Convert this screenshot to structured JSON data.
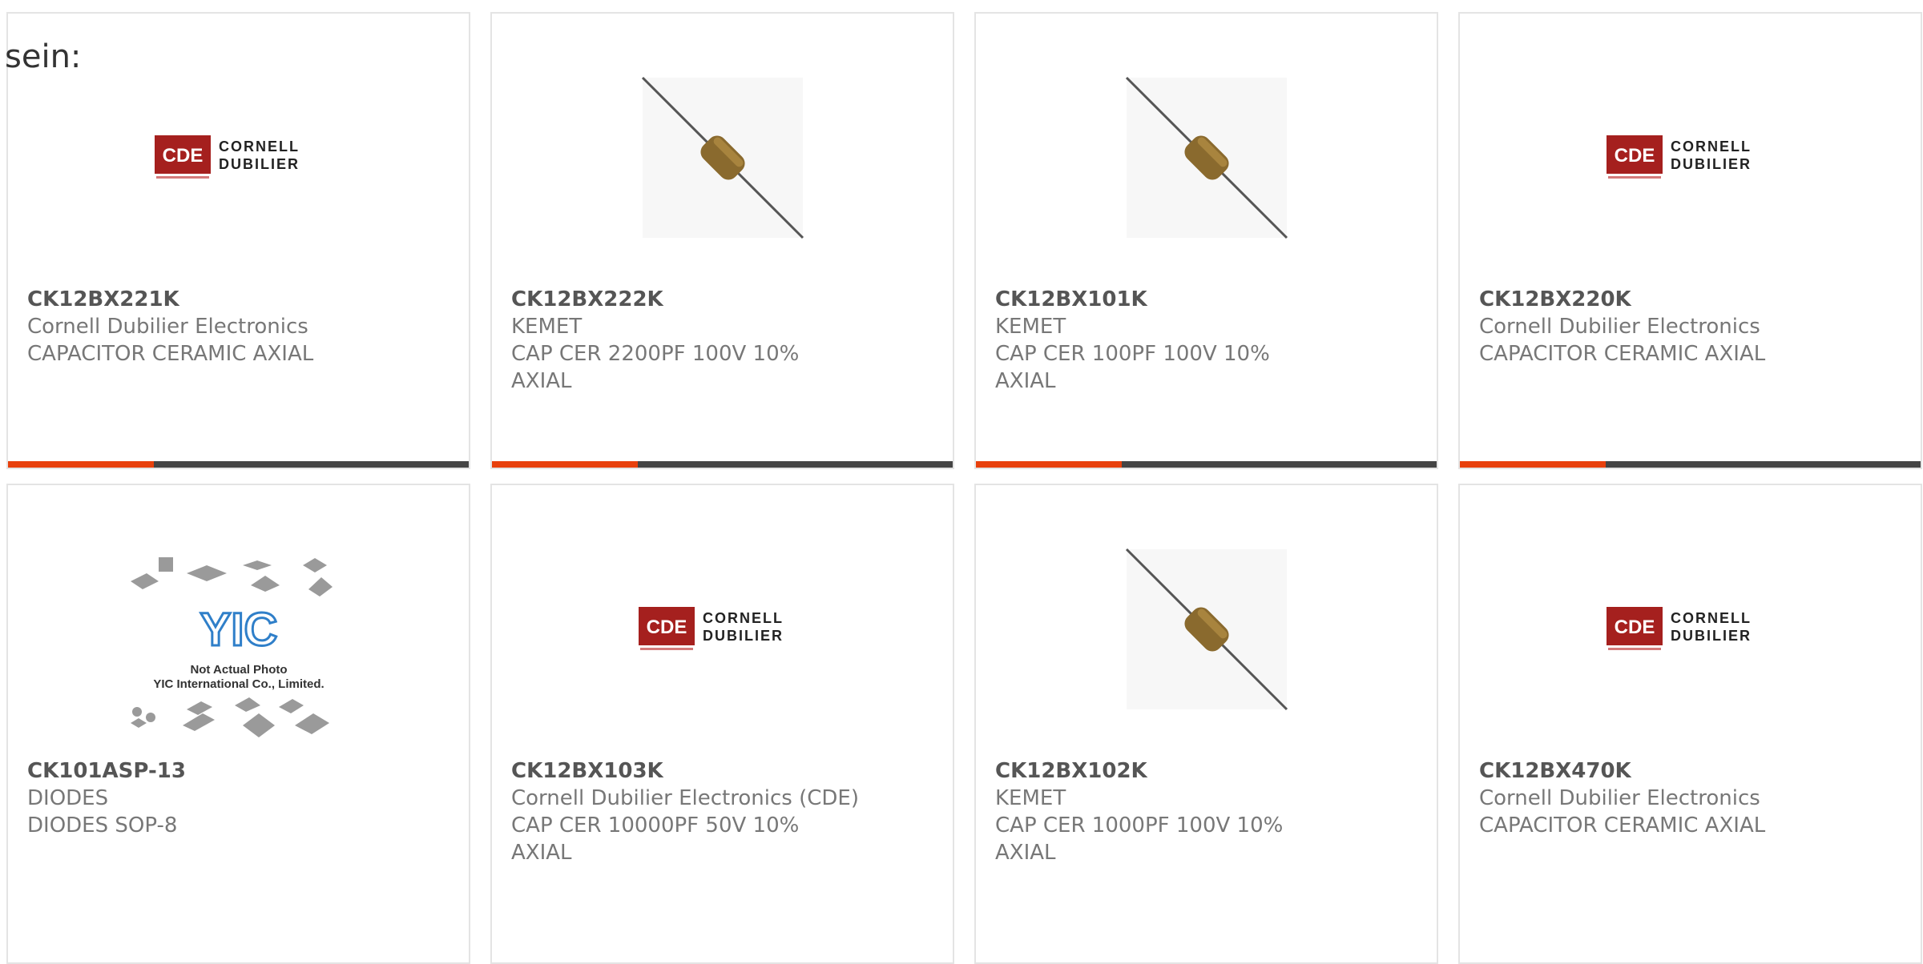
{
  "intro_text": "sein:",
  "colors": {
    "accent": "#e8400c",
    "bar": "#444444",
    "cde_red": "#a5201e"
  },
  "logos": {
    "cde": {
      "mark": "CDE",
      "line1": "CORNELL",
      "line2": "DUBILIER"
    },
    "yic": {
      "mark": "YIC",
      "line1": "Not Actual Photo",
      "line2": "YIC International Co., Limited."
    }
  },
  "products": [
    {
      "part": "CK12BX221K",
      "manufacturer": "Cornell Dubilier Electronics",
      "description": "CAPACITOR CERAMIC AXIAL",
      "image": "cde-logo"
    },
    {
      "part": "CK12BX222K",
      "manufacturer": "KEMET",
      "description": "CAP CER 2200PF 100V 10% AXIAL",
      "image": "axial-capacitor"
    },
    {
      "part": "CK12BX101K",
      "manufacturer": "KEMET",
      "description": "CAP CER 100PF 100V 10% AXIAL",
      "image": "axial-capacitor"
    },
    {
      "part": "CK12BX220K",
      "manufacturer": "Cornell Dubilier Electronics",
      "description": "CAPACITOR CERAMIC AXIAL",
      "image": "cde-logo"
    },
    {
      "part": "CK101ASP-13",
      "manufacturer": "DIODES",
      "description": "DIODES SOP-8",
      "image": "yic-placeholder"
    },
    {
      "part": "CK12BX103K",
      "manufacturer": "Cornell Dubilier Electronics (CDE)",
      "description": "CAP CER 10000PF 50V 10% AXIAL",
      "image": "cde-logo"
    },
    {
      "part": "CK12BX102K",
      "manufacturer": "KEMET",
      "description": "CAP CER 1000PF 100V 10% AXIAL",
      "image": "axial-capacitor"
    },
    {
      "part": "CK12BX470K",
      "manufacturer": "Cornell Dubilier Electronics",
      "description": "CAPACITOR CERAMIC AXIAL",
      "image": "cde-logo"
    }
  ]
}
